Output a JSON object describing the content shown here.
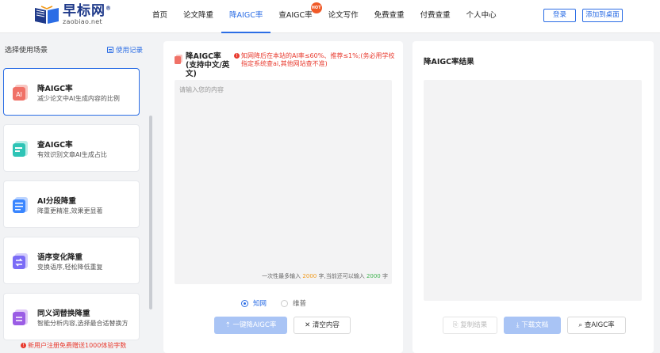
{
  "logo": {
    "name": "早标网",
    "reg": "®",
    "domain": "zaobiao.net"
  },
  "nav": [
    {
      "label": "首页"
    },
    {
      "label": "论文降重"
    },
    {
      "label": "降AIGC率"
    },
    {
      "label": "查AIGC率",
      "badge": "HOT"
    },
    {
      "label": "论文写作"
    },
    {
      "label": "免费查重"
    },
    {
      "label": "付费查重"
    },
    {
      "label": "个人中心"
    }
  ],
  "nav_active": "降AIGC率",
  "header_buttons": {
    "login": "登录",
    "add_desktop": "添加到桌面"
  },
  "sidebar": {
    "title": "选择使用场景",
    "record": "使用记录",
    "items": [
      {
        "title": "降AIGC率",
        "desc": "减少论文中AI生成内容的比例",
        "icon": "reduce-ai-icon",
        "color": "#f07167"
      },
      {
        "title": "查AIGC率",
        "desc": "有效识别文章AI生成占比",
        "icon": "check-ai-icon",
        "color": "#2ec4b6"
      },
      {
        "title": "AI分段降重",
        "desc": "降重更精准,效果更显著",
        "icon": "segment-icon",
        "color": "#3a86ff"
      },
      {
        "title": "语序变化降重",
        "desc": "变换语序,轻松降低重复",
        "icon": "reorder-icon",
        "color": "#7b6cf6"
      },
      {
        "title": "同义词替换降重",
        "desc": "智能分析内容,选择最合适替换方",
        "icon": "synonym-icon",
        "color": "#9b5de5"
      }
    ],
    "promo": "新用户注册免费赠送1000体验字数"
  },
  "editor": {
    "title": "降AIGC率(支持中文/英文)",
    "warning": "知网降后在本站的AI率≤60%、推荐≤1%;(务必用学校指定系统查ai,其他网站查不准)",
    "placeholder": "请输入您的内容",
    "count_prefix": "一次性最多输入",
    "count_max": "2000",
    "count_mid": "字,当前还可以输入",
    "count_remain": "2000",
    "count_suffix": "字",
    "radios": [
      {
        "label": "知网",
        "checked": true
      },
      {
        "label": "维普",
        "checked": false
      }
    ],
    "primary_button": "一键降AIGC率",
    "clear_button": "清空内容"
  },
  "result": {
    "title": "降AIGC率结果",
    "copy_button": "复制结果",
    "download_button": "下载文档",
    "check_button": "查AIGC率"
  },
  "colors": {
    "accent": "#2b6de5",
    "warning": "#e83a2e",
    "disabled_primary": "#a9c4f5"
  }
}
